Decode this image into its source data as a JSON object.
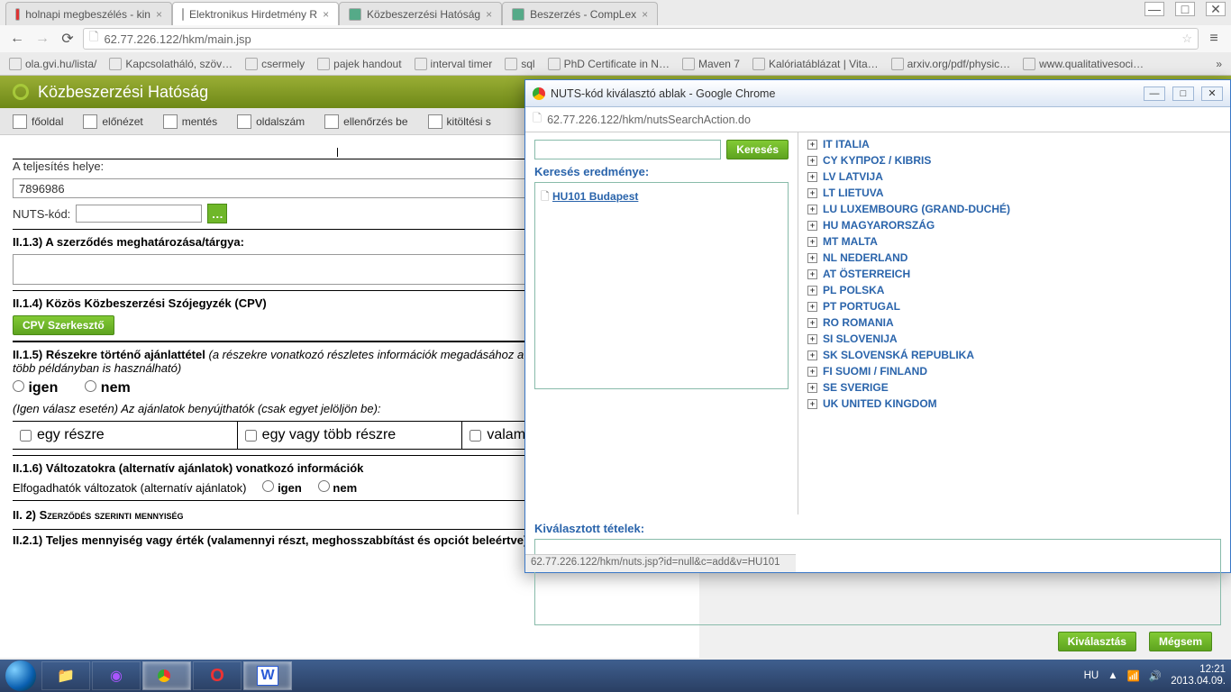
{
  "browser": {
    "tabs": [
      {
        "label": "holnapi megbeszélés - kin",
        "active": false,
        "icon": "#d33"
      },
      {
        "label": "Elektronikus Hirdetmény R",
        "active": true,
        "icon": "#888"
      },
      {
        "label": "Közbeszerzési Hatóság",
        "active": false,
        "icon": "#5a8"
      },
      {
        "label": "Beszerzés - CompLex",
        "active": false,
        "icon": "#5a8"
      }
    ],
    "url": "62.77.226.122/hkm/main.jsp",
    "bookmarks": [
      "ola.gvi.hu/lista/",
      "Kapcsolatháló, szöv…",
      "csermely",
      "pajek handout",
      "interval timer",
      "sql",
      "PhD Certificate in N…",
      "Maven 7",
      "Kalóriatáblázat | Vita…",
      "arxiv.org/pdf/physic…",
      "www.qualitativesoci…"
    ]
  },
  "app": {
    "title": "Közbeszerzési Hatóság",
    "toolbar": [
      "főoldal",
      "előnézet",
      "mentés",
      "oldalszám",
      "ellenőrzés be",
      "kitöltési s"
    ]
  },
  "form": {
    "teljesites_label": "A teljesítés helye:",
    "teljesites_value": "7896986",
    "nuts_label": "NUTS-kód:",
    "nuts_value": "",
    "s113": "II.1.3) A szerződés meghatározása/tárgya:",
    "s114": "II.1.4) Közös Közbeszerzési Szójegyzék (CPV)",
    "cpv_btn": "CPV Szerkesztő",
    "s115_title": "II.1.5) Részekre történő ajánlattétel",
    "s115_note": "(a részekre vonatkozó részletes információk megadásához a B. melléklet szükség szerint több példányban is használható)",
    "igen": "igen",
    "nem": "nem",
    "s115_sub": "(Igen válasz esetén) Az ajánlatok benyújthatók (csak egyet jelöljön be):",
    "cell1": "egy részre",
    "cell2": "egy vagy több részre",
    "cell3": "valamennyi részre",
    "s116_title": "II.1.6) Változatokra (alternatív ajánlatok) vonatkozó információk",
    "s116_sub": "Elfogadhatók változatok (alternatív ajánlatok)",
    "s2": "II. 2) Szerződés szerinti mennyiség",
    "s121": "II.2.1) Teljes mennyiség vagy érték (valamennyi részt, meghosszabbítást és opciót beleértve)"
  },
  "popup": {
    "title": "NUTS-kód kiválasztó ablak - Google Chrome",
    "url": "62.77.226.122/hkm/nutsSearchAction.do",
    "search_btn": "Keresés",
    "result_head": "Keresés eredménye:",
    "result_link": "HU101 Budapest",
    "selected_head": "Kiválasztott tételek:",
    "ok": "Kiválasztás",
    "cancel": "Mégsem",
    "status": "62.77.226.122/hkm/nuts.jsp?id=null&c=add&v=HU101",
    "tree": [
      "IT ITALIA",
      "CY ΚΥΠΡΟΣ / KIBRIS",
      "LV LATVIJA",
      "LT LIETUVA",
      "LU LUXEMBOURG (GRAND-DUCHÉ)",
      "HU MAGYARORSZÁG",
      "MT MALTA",
      "NL NEDERLAND",
      "AT ÖSTERREICH",
      "PL POLSKA",
      "PT PORTUGAL",
      "RO ROMANIA",
      "SI SLOVENIJA",
      "SK SLOVENSKÁ REPUBLIKA",
      "FI SUOMI / FINLAND",
      "SE SVERIGE",
      "UK UNITED KINGDOM"
    ]
  },
  "taskbar": {
    "lang": "HU",
    "time": "12:21",
    "date": "2013.04.09."
  }
}
